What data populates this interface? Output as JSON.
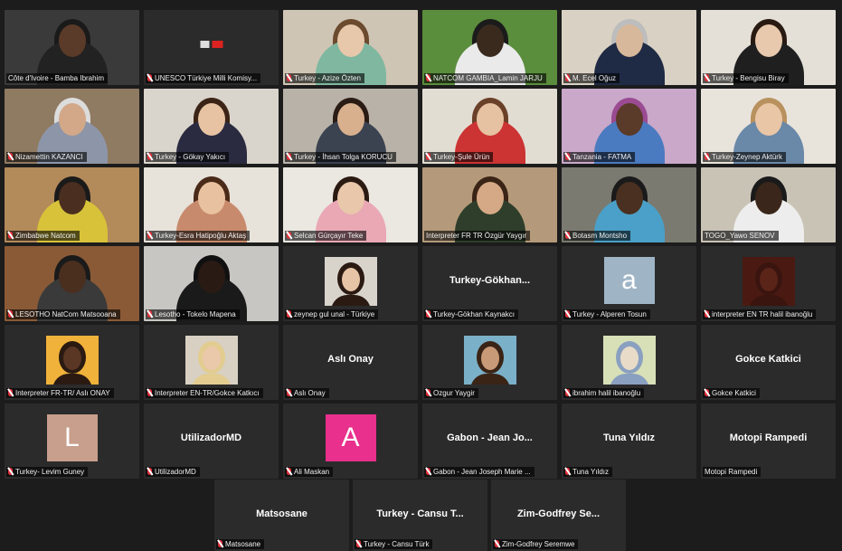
{
  "tiles": [
    {
      "name": "Côte d'Ivoire - Bamba Ibrahim",
      "kind": "video",
      "bg": "#3a3a3a",
      "skin": "#5a3a28",
      "shirt": "#222",
      "hair": "#1a1a1a",
      "mute": false
    },
    {
      "name": "UNESCO Türkiye Milli Komisy...",
      "kind": "logo",
      "bg": "#2e2e2e",
      "mute": true
    },
    {
      "name": "Turkey - Azize Özten",
      "kind": "video",
      "bg": "#cfc5b4",
      "skin": "#e8c8aa",
      "shirt": "#7fb7a0",
      "hair": "#6b4a2e",
      "mute": true
    },
    {
      "name": "NATCOM GAMBIA_Lamin JARJU",
      "kind": "video",
      "bg": "#5a8d3c",
      "skin": "#3a2a1e",
      "shirt": "#eaeaea",
      "hair": "#1b1b1b",
      "mute": true
    },
    {
      "name": "M. Ecel Oğuz",
      "kind": "video",
      "bg": "#d9d2c4",
      "skin": "#d8b89a",
      "shirt": "#1f2a44",
      "hair": "#bdbdbd",
      "mute": true,
      "active": true
    },
    {
      "name": "Turkey - Bengisu Biray",
      "kind": "video",
      "bg": "#e4e0d8",
      "skin": "#e9c9ad",
      "shirt": "#1f1f1f",
      "hair": "#2a1b12",
      "mute": true
    },
    {
      "name": "Nizamettin KAZANCI",
      "kind": "video",
      "bg": "#8f7a62",
      "skin": "#d2a888",
      "shirt": "#8d96a8",
      "hair": "#dcdcdc",
      "mute": true
    },
    {
      "name": "Turkey - Gökay Yakıcı",
      "kind": "video",
      "bg": "#d9d4cc",
      "skin": "#e7c3a3",
      "shirt": "#2a2a40",
      "hair": "#3b2416",
      "mute": true
    },
    {
      "name": "Turkey - İhsan Tolga KORUCU",
      "kind": "video",
      "bg": "#b8b2a8",
      "skin": "#d8b08e",
      "shirt": "#3b4250",
      "hair": "#2a1c14",
      "mute": true
    },
    {
      "name": "Turkey-Şule Ürün",
      "kind": "video",
      "bg": "#e2ddd3",
      "skin": "#e6c2a2",
      "shirt": "#c33",
      "hair": "#6b4028",
      "mute": true
    },
    {
      "name": "Tanzania - FATMA",
      "kind": "video",
      "bg": "#c9a8c9",
      "skin": "#5a3a28",
      "shirt": "#4a7ac0",
      "hair": "#9a4b92",
      "mute": true
    },
    {
      "name": "Turkey-Zeynep Aktürk",
      "kind": "video",
      "bg": "#e8e4dc",
      "skin": "#e9c6a6",
      "shirt": "#6a88a8",
      "hair": "#b8915e",
      "mute": true
    },
    {
      "name": "Zimbabwe Natcom",
      "kind": "video",
      "bg": "#b38a5a",
      "skin": "#4a2e20",
      "shirt": "#d8c23a",
      "hair": "#1a1a1a",
      "mute": true
    },
    {
      "name": "Turkey-Esra Hatipoğlu Aktaş",
      "kind": "video",
      "bg": "#e7e2da",
      "skin": "#e8c2a0",
      "shirt": "#c88a6c",
      "hair": "#4a2a18",
      "mute": true
    },
    {
      "name": "Selcan Gürçayır Teke",
      "kind": "video",
      "bg": "#ebe7e1",
      "skin": "#e8c7aa",
      "shirt": "#e9a8b4",
      "hair": "#2a1a12",
      "mute": true
    },
    {
      "name": "Interpreter FR TR Özgür Yaygır",
      "kind": "video",
      "bg": "#b49a7a",
      "skin": "#d6a986",
      "shirt": "#2e3e2a",
      "hair": "#3a2416",
      "mute": false
    },
    {
      "name": "Botasm Montsho",
      "kind": "video",
      "bg": "#7a7a70",
      "skin": "#4a3020",
      "shirt": "#4aa0c8",
      "hair": "#1a1a1a",
      "mute": true
    },
    {
      "name": "TOGO_Yawo SENOV",
      "kind": "video",
      "bg": "#c9c3b6",
      "skin": "#3a261a",
      "shirt": "#ededed",
      "hair": "#1a1a1a",
      "mute": false
    },
    {
      "name": "LESOTHO NatCom Matsooana",
      "kind": "video",
      "bg": "#8a5a36",
      "skin": "#4a2e1e",
      "shirt": "#3a3a3a",
      "hair": "#1a1a1a",
      "mute": true
    },
    {
      "name": "Lesotho - Tokelo Mapena",
      "kind": "video",
      "bg": "#c8c6c2",
      "skin": "#2a1a14",
      "shirt": "#1a1a1a",
      "hair": "#101010",
      "mute": true
    },
    {
      "name": "zeynep gul unal - Türkiye",
      "kind": "photo",
      "photoBg": "#d8d4cc",
      "skin": "#e7c4a6",
      "hair": "#2a1a12",
      "mute": true
    },
    {
      "name": "Turkey-Gökhan Kaynakcı",
      "kind": "text",
      "title": "Turkey-Gökhan...",
      "mute": true
    },
    {
      "name": "Turkey - Alperen Tosun",
      "kind": "letter",
      "letter": "a",
      "color": "#9fb5c6",
      "mute": true
    },
    {
      "name": "interpreter EN TR halil ibanoğlu",
      "kind": "photo",
      "photoBg": "#4a1a12",
      "skin": "#5a2418",
      "hair": "#3a140e",
      "mute": true
    },
    {
      "name": "Interpreter FR-TR/ Aslı ONAY",
      "kind": "photo",
      "photoBg": "#f0b23a",
      "skin": "#5a3624",
      "hair": "#2a1a12",
      "mute": true
    },
    {
      "name": "Interpreter EN-TR/Gokce Katkıcı",
      "kind": "photo",
      "photoBg": "#d8d0c2",
      "skin": "#eac8aa",
      "hair": "#e2cc90",
      "mute": true
    },
    {
      "name": "Aslı Onay",
      "kind": "text",
      "title": "Aslı Onay",
      "mute": true
    },
    {
      "name": "Ozgur Yaygir",
      "kind": "photo",
      "photoBg": "#7ab0c8",
      "skin": "#c89a78",
      "hair": "#3a2416",
      "mute": true
    },
    {
      "name": "ibrahim halil ibanoğlu",
      "kind": "photo",
      "photoBg": "#d8e0b8",
      "skin": "#e8dcc8",
      "hair": "#8aa0c0",
      "mute": true
    },
    {
      "name": "Gokce Katkici",
      "kind": "text",
      "title": "Gokce Katkici",
      "mute": true
    },
    {
      "name": "Turkey- Levim Guney",
      "kind": "letter",
      "letter": "L",
      "color": "#c89e8c",
      "mute": true
    },
    {
      "name": "UtilizadorMD",
      "kind": "text",
      "title": "UtilizadorMD",
      "mute": true
    },
    {
      "name": "Ali Maskan",
      "kind": "letter",
      "letter": "A",
      "color": "#e8308c",
      "mute": true
    },
    {
      "name": "Gabon - Jean Joseph Marie ...",
      "kind": "text",
      "title": "Gabon - Jean Jo...",
      "mute": true
    },
    {
      "name": "Tuna Yıldız",
      "kind": "text",
      "title": "Tuna Yıldız",
      "mute": true
    },
    {
      "name": "Motopi Rampedi",
      "kind": "text",
      "title": "Motopi Rampedi",
      "mute": false
    }
  ],
  "last_row": [
    {
      "name": "Matsosane",
      "kind": "text",
      "title": "Matsosane",
      "mute": true
    },
    {
      "name": "Turkey - Cansu Türk",
      "kind": "text",
      "title": "Turkey - Cansu T...",
      "mute": true
    },
    {
      "name": "Zim-Godfrey Seremwe",
      "kind": "text",
      "title": "Zim-Godfrey Se...",
      "mute": true
    }
  ]
}
